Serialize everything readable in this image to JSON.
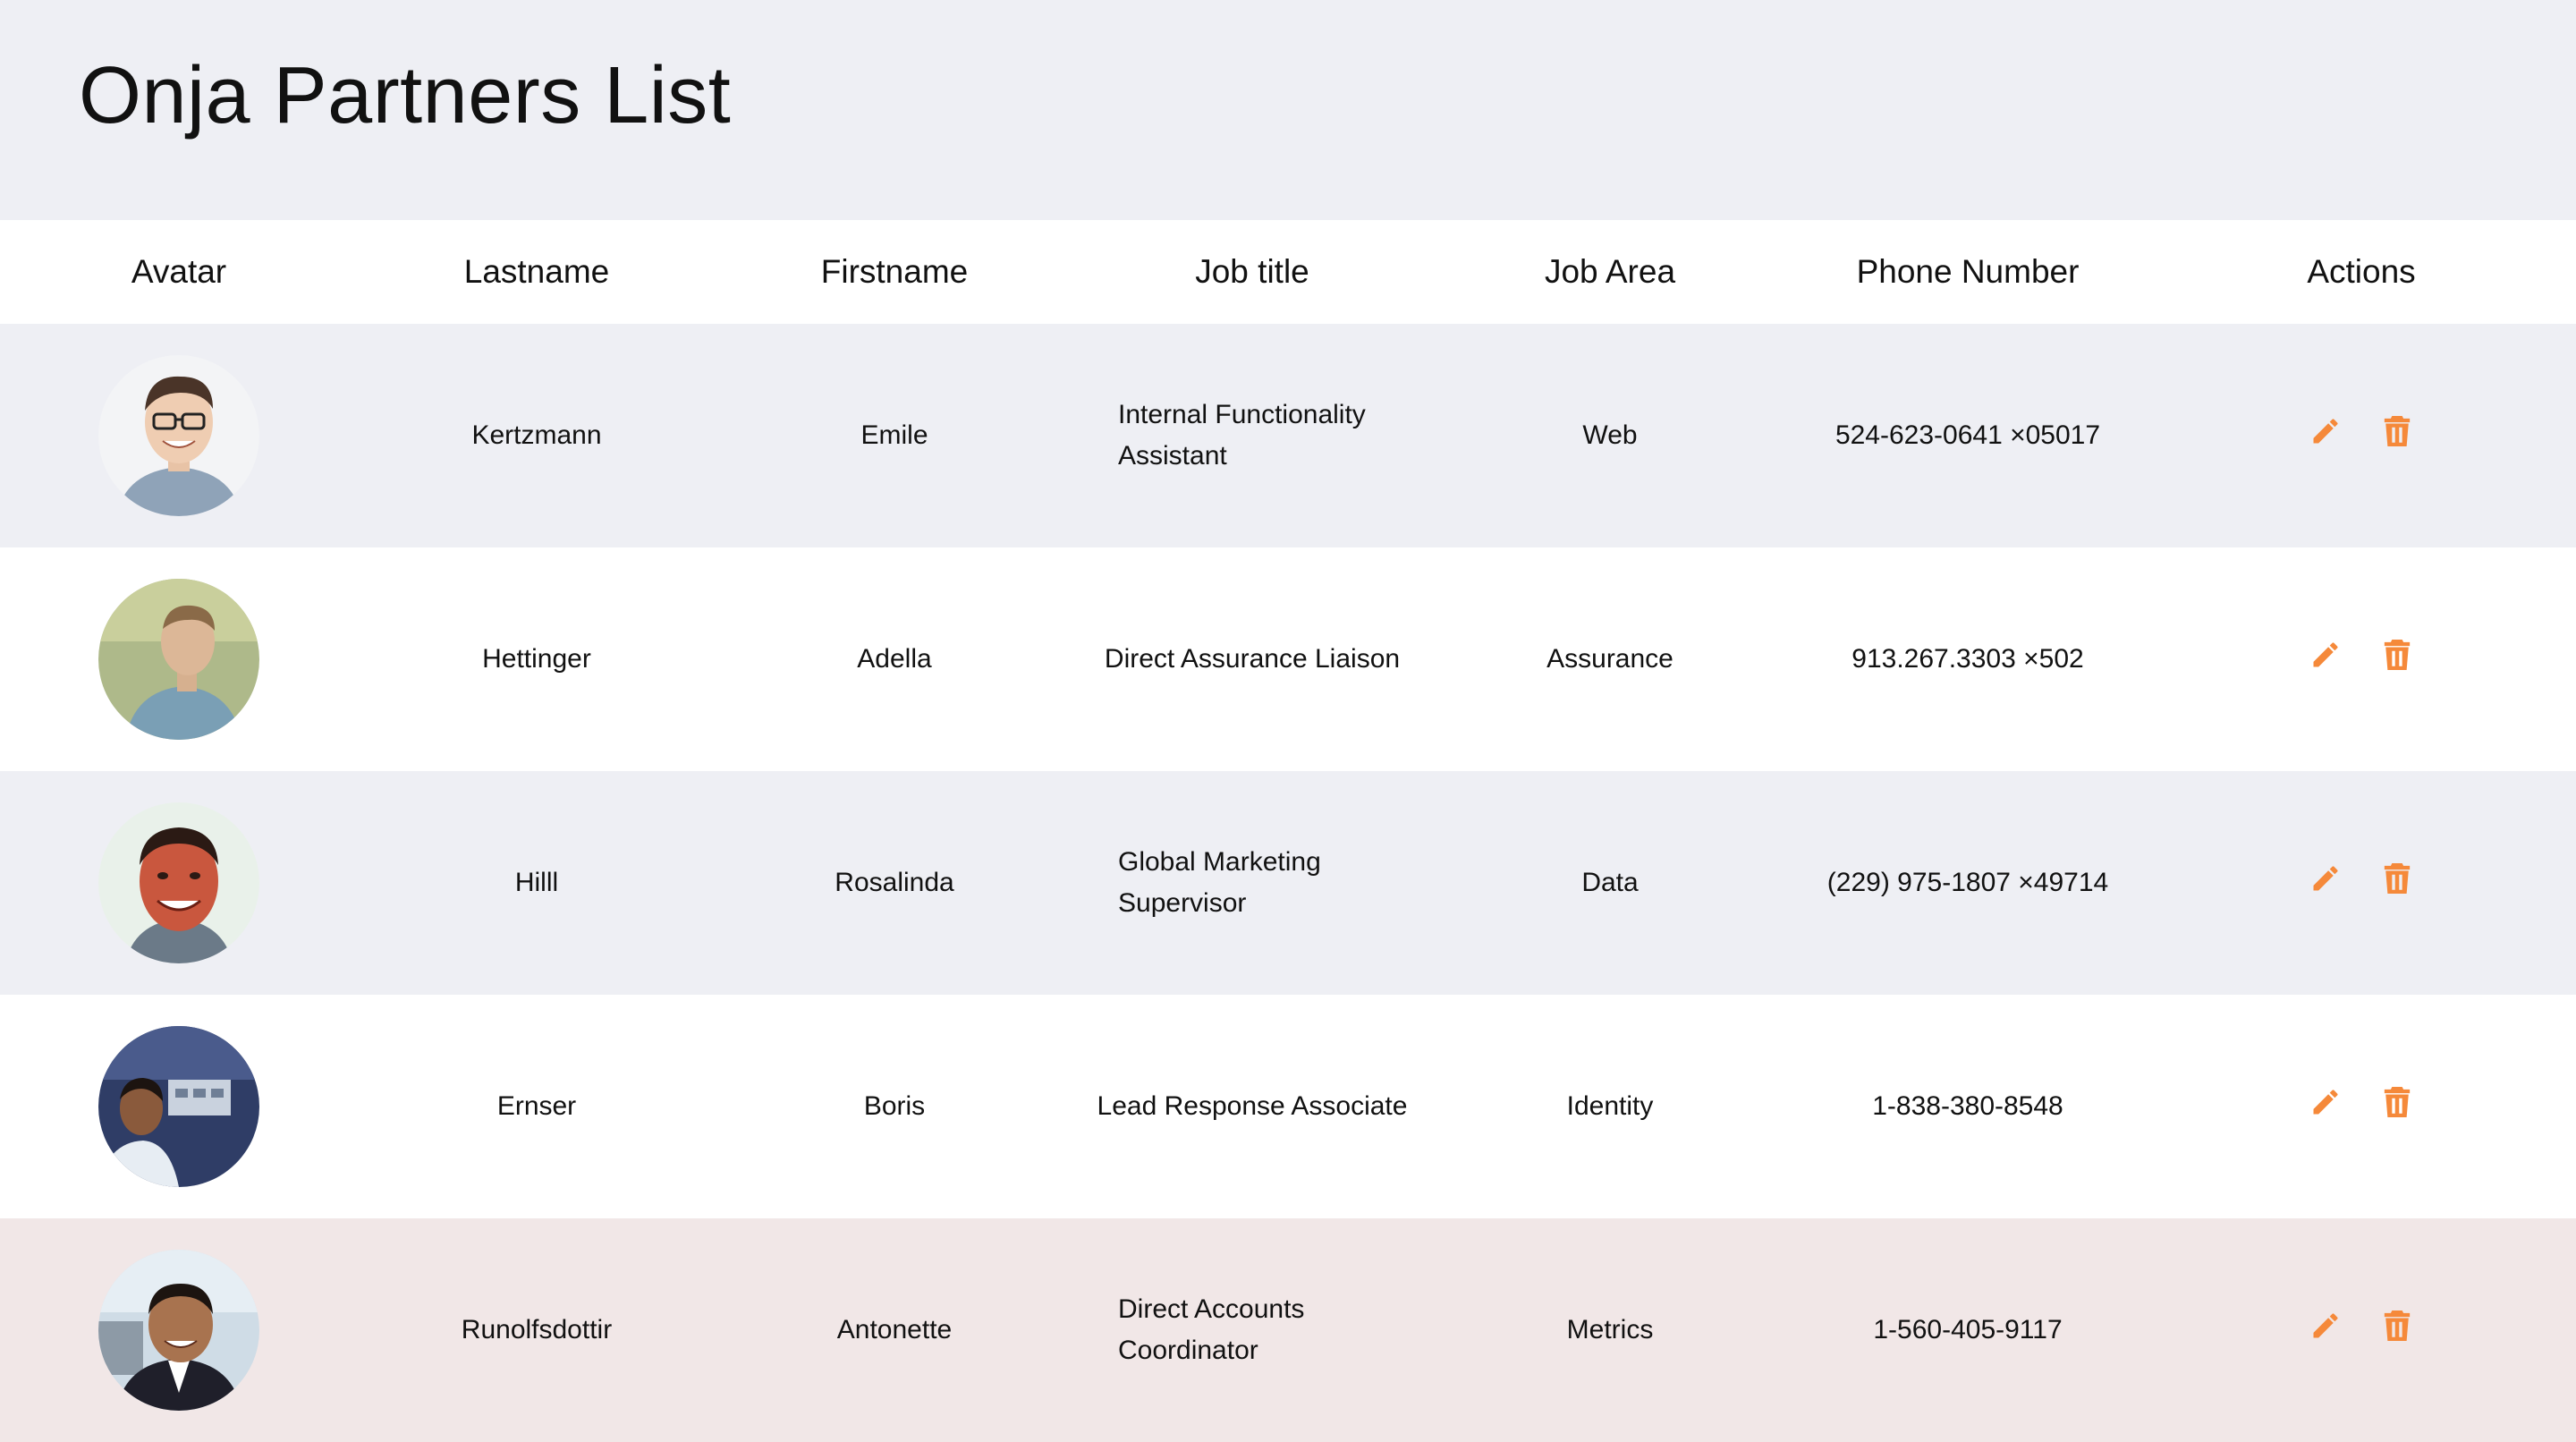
{
  "page": {
    "title": "Onja Partners List"
  },
  "colors": {
    "accent": "#f5893a",
    "row_shaded": "#eeeff4",
    "row_white": "#ffffff",
    "row_highlight": "#f1e7e7"
  },
  "table": {
    "headers": {
      "avatar": "Avatar",
      "lastname": "Lastname",
      "firstname": "Firstname",
      "job_title": "Job title",
      "job_area": "Job Area",
      "phone": "Phone Number",
      "actions": "Actions"
    },
    "rows": [
      {
        "lastname": "Kertzmann",
        "firstname": "Emile",
        "job_title": "Internal Functionality Assistant",
        "job_area": "Web",
        "phone": "524-623-0641 ×05017",
        "actions": [
          "edit-icon",
          "trash-icon"
        ]
      },
      {
        "lastname": "Hettinger",
        "firstname": "Adella",
        "job_title": "Direct Assurance Liaison",
        "job_area": "Assurance",
        "phone": "913.267.3303 ×502",
        "actions": [
          "edit-icon",
          "trash-icon"
        ]
      },
      {
        "lastname": "Hilll",
        "firstname": "Rosalinda",
        "job_title": "Global Marketing Supervisor",
        "job_area": "Data",
        "phone": "(229) 975-1807 ×49714",
        "actions": [
          "edit-icon",
          "trash-icon"
        ]
      },
      {
        "lastname": "Ernser",
        "firstname": "Boris",
        "job_title": "Lead Response Associate",
        "job_area": "Identity",
        "phone": "1-838-380-8548",
        "actions": [
          "edit-icon",
          "trash-icon"
        ]
      },
      {
        "lastname": "Runolfsdottir",
        "firstname": "Antonette",
        "job_title": "Direct Accounts Coordinator",
        "job_area": "Metrics",
        "phone": "1-560-405-9117",
        "actions": [
          "edit-icon",
          "trash-icon"
        ]
      }
    ]
  }
}
